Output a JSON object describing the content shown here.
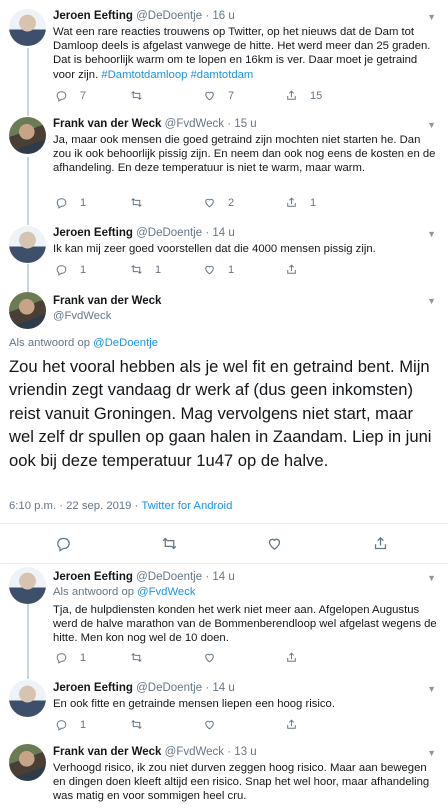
{
  "colors": {
    "link": "#1b95e0",
    "meta": "#657786",
    "text": "#14171a",
    "divider": "#e6ecf0"
  },
  "tweets": [
    {
      "name": "Jeroen Eefting",
      "handle": "@DeDoentje",
      "sep": "·",
      "time": "16 u",
      "text": "Wat een rare reacties trouwens op Twitter, op het nieuws dat de Dam tot Damloop deels is afgelast vanwege de hitte. Het werd meer dan 25 graden. Dat is behoorlijk warm om te lopen en 16km is ver. Daar moet je getraind voor zijn.",
      "hashtags": "#Damtotdamloop #damtotdam",
      "replies": "7",
      "retweets": "",
      "likes": "7",
      "share": "15"
    },
    {
      "name": "Frank van der Weck",
      "handle": "@FvdWeck",
      "sep": "·",
      "time": "15 u",
      "text": "Ja, maar ook mensen die goed getraind zijn mochten niet starten he. Dan zou ik ook behoorlijk pissig zijn. En neem dan ook nog eens de kosten en de afhandeling. En deze temperatuur is niet te warm, maar warm.",
      "replies": "1",
      "retweets": "",
      "likes": "2",
      "share": "1"
    },
    {
      "name": "Jeroen Eefting",
      "handle": "@DeDoentje",
      "sep": "·",
      "time": "14 u",
      "text": "Ik kan mij zeer goed voorstellen dat die 4000 mensen pissig  zijn.",
      "replies": "1",
      "retweets": "1",
      "likes": "1",
      "share": ""
    }
  ],
  "focused": {
    "name": "Frank van der Weck",
    "handle": "@FvdWeck",
    "reply_prefix": "Als antwoord op",
    "reply_to": "@DeDoentje",
    "text": "Zou het vooral hebben als je wel fit en getraind bent. Mijn vriendin zegt vandaag dr werk af (dus geen inkomsten) reist vanuit Groningen. Mag vervolgens niet start, maar wel zelf dr spullen op gaan halen in Zaandam. Liep in juni ook bij deze temperatuur 1u47 op de halve.",
    "timestamp": "6:10 p.m. · 22 sep. 2019 ·",
    "source": "Twitter for Android"
  },
  "replies": [
    {
      "name": "Jeroen Eefting",
      "handle": "@DeDoentje",
      "sep": "·",
      "time": "14 u",
      "reply_prefix": "Als antwoord op",
      "reply_to": "@FvdWeck",
      "text": "Tja, de hulpdiensten konden het werk niet meer aan. Afgelopen Augustus werd de halve marathon van de Bommenberendloop wel afgelast wegens de hitte. Men kon nog wel de 10 doen.",
      "replies": "1",
      "retweets": "",
      "likes": "",
      "share": ""
    },
    {
      "name": "Jeroen Eefting",
      "handle": "@DeDoentje",
      "sep": "·",
      "time": "14 u",
      "text": "En ook fitte en getrainde mensen liepen een hoog risico.",
      "replies": "1",
      "retweets": "",
      "likes": "",
      "share": ""
    },
    {
      "name": "Frank van der Weck",
      "handle": "@FvdWeck",
      "sep": "·",
      "time": "13 u",
      "text": "Verhoogd risico, ik zou niet durven zeggen hoog risico. Maar aan bewegen en dingen doen kleeft altijd een risico. Snap het wel hoor, maar afhandeling was matig en voor sommigen heel cru."
    }
  ],
  "icons": {
    "reply": "reply-icon",
    "retweet": "retweet-icon",
    "like": "heart-icon",
    "share": "share-icon",
    "caret": "chevron-down-icon"
  }
}
